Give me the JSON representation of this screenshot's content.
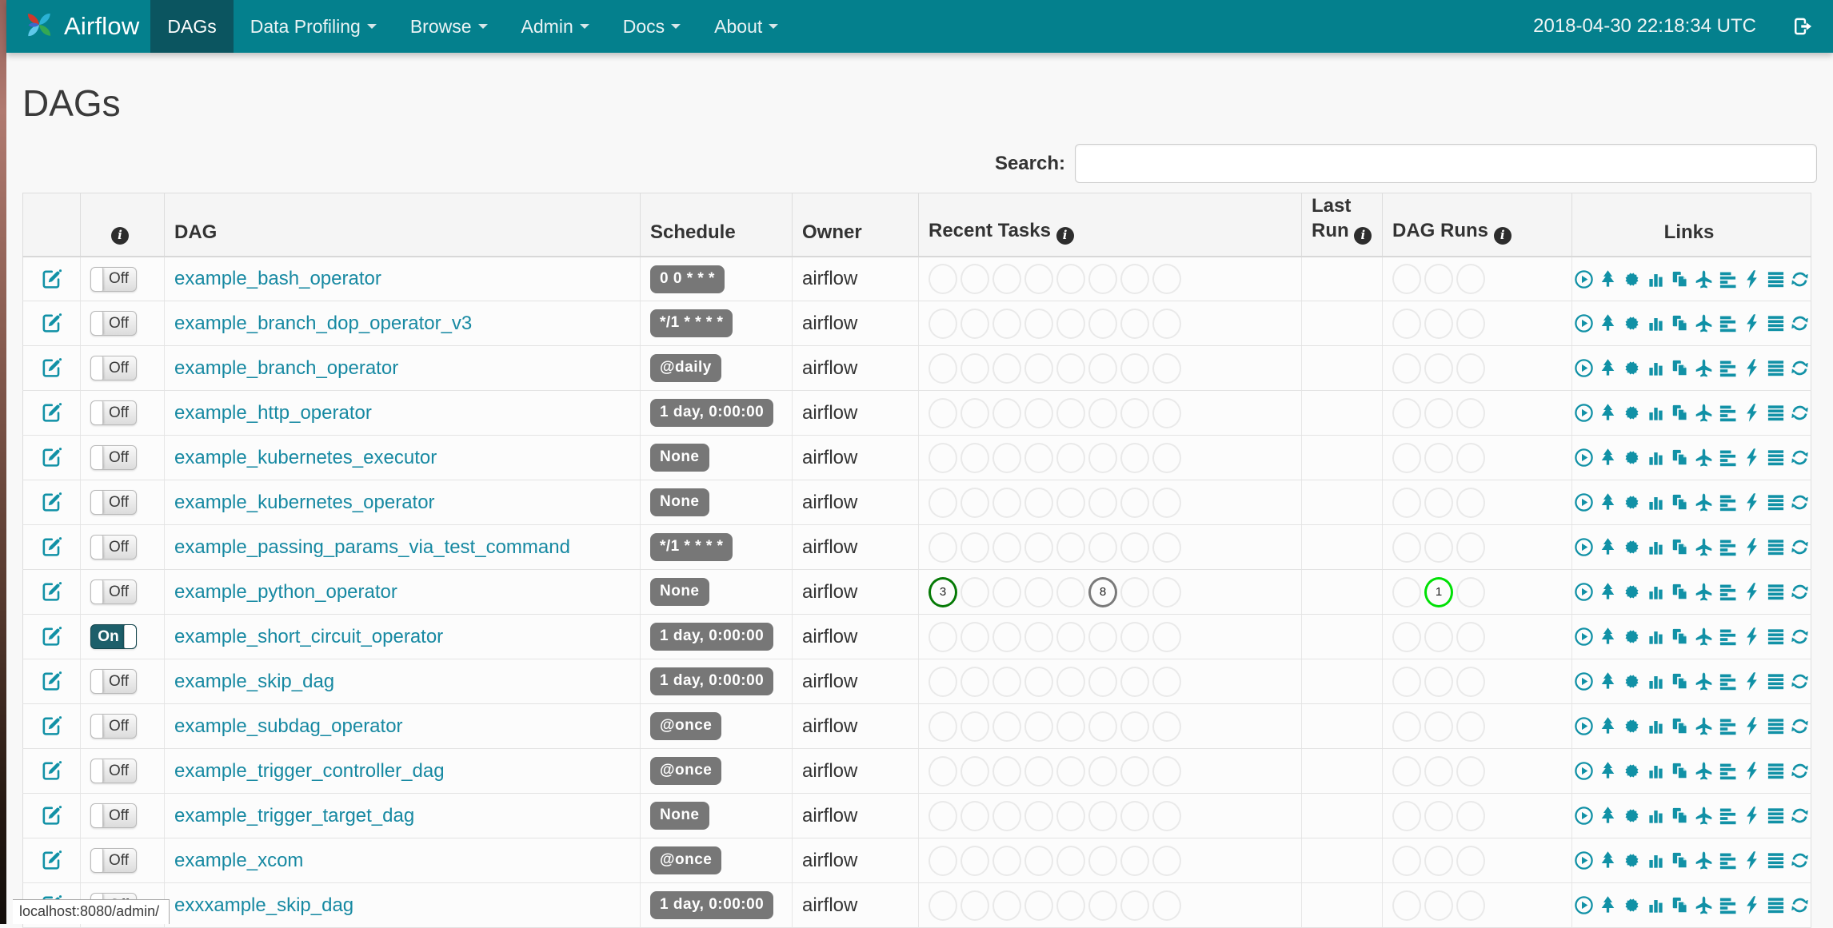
{
  "navbar": {
    "brand": "Airflow",
    "items": [
      {
        "label": "DAGs",
        "active": true,
        "caret": false
      },
      {
        "label": "Data Profiling",
        "active": false,
        "caret": true
      },
      {
        "label": "Browse",
        "active": false,
        "caret": true
      },
      {
        "label": "Admin",
        "active": false,
        "caret": true
      },
      {
        "label": "Docs",
        "active": false,
        "caret": true
      },
      {
        "label": "About",
        "active": false,
        "caret": true
      }
    ],
    "clock": "2018-04-30 22:18:34 UTC"
  },
  "page": {
    "title": "DAGs"
  },
  "search": {
    "label": "Search:",
    "value": "",
    "placeholder": ""
  },
  "table": {
    "headers": {
      "edit": "",
      "dag": "DAG",
      "schedule": "Schedule",
      "owner": "Owner",
      "recent_tasks": "Recent Tasks",
      "last_run": "Last Run",
      "dag_runs": "DAG Runs",
      "links": "Links"
    },
    "recent_task_slots": 8,
    "dag_run_slots": 3,
    "links": [
      "trigger-dag",
      "tree-view",
      "graph-view",
      "task-duration",
      "task-tries",
      "landing-times",
      "gantt-view",
      "code-view",
      "log-view",
      "refresh"
    ],
    "rows": [
      {
        "toggle": "Off",
        "dag": "example_bash_operator",
        "schedule": "0 0 * * *",
        "owner": "airflow",
        "last_run": "",
        "recent_tasks": [],
        "dag_runs": []
      },
      {
        "toggle": "Off",
        "dag": "example_branch_dop_operator_v3",
        "schedule": "*/1 * * * *",
        "owner": "airflow",
        "last_run": "",
        "recent_tasks": [],
        "dag_runs": []
      },
      {
        "toggle": "Off",
        "dag": "example_branch_operator",
        "schedule": "@daily",
        "owner": "airflow",
        "last_run": "",
        "recent_tasks": [],
        "dag_runs": []
      },
      {
        "toggle": "Off",
        "dag": "example_http_operator",
        "schedule": "1 day, 0:00:00",
        "owner": "airflow",
        "last_run": "",
        "recent_tasks": [],
        "dag_runs": []
      },
      {
        "toggle": "Off",
        "dag": "example_kubernetes_executor",
        "schedule": "None",
        "owner": "airflow",
        "last_run": "",
        "recent_tasks": [],
        "dag_runs": []
      },
      {
        "toggle": "Off",
        "dag": "example_kubernetes_operator",
        "schedule": "None",
        "owner": "airflow",
        "last_run": "",
        "recent_tasks": [],
        "dag_runs": []
      },
      {
        "toggle": "Off",
        "dag": "example_passing_params_via_test_command",
        "schedule": "*/1 * * * *",
        "owner": "airflow",
        "last_run": "",
        "recent_tasks": [],
        "dag_runs": []
      },
      {
        "toggle": "Off",
        "dag": "example_python_operator",
        "schedule": "None",
        "owner": "airflow",
        "last_run": "",
        "recent_tasks": [
          {
            "slot": 1,
            "count": "3",
            "state": "success"
          },
          {
            "slot": 6,
            "count": "8",
            "state": "queued"
          }
        ],
        "dag_runs": [
          {
            "slot": 2,
            "count": "1",
            "state": "running"
          }
        ]
      },
      {
        "toggle": "On",
        "dag": "example_short_circuit_operator",
        "schedule": "1 day, 0:00:00",
        "owner": "airflow",
        "last_run": "",
        "recent_tasks": [],
        "dag_runs": []
      },
      {
        "toggle": "Off",
        "dag": "example_skip_dag",
        "schedule": "1 day, 0:00:00",
        "owner": "airflow",
        "last_run": "",
        "recent_tasks": [],
        "dag_runs": []
      },
      {
        "toggle": "Off",
        "dag": "example_subdag_operator",
        "schedule": "@once",
        "owner": "airflow",
        "last_run": "",
        "recent_tasks": [],
        "dag_runs": []
      },
      {
        "toggle": "Off",
        "dag": "example_trigger_controller_dag",
        "schedule": "@once",
        "owner": "airflow",
        "last_run": "",
        "recent_tasks": [],
        "dag_runs": []
      },
      {
        "toggle": "Off",
        "dag": "example_trigger_target_dag",
        "schedule": "None",
        "owner": "airflow",
        "last_run": "",
        "recent_tasks": [],
        "dag_runs": []
      },
      {
        "toggle": "Off",
        "dag": "example_xcom",
        "schedule": "@once",
        "owner": "airflow",
        "last_run": "",
        "recent_tasks": [],
        "dag_runs": []
      },
      {
        "toggle": "Off",
        "dag": "exxxample_skip_dag",
        "schedule": "1 day, 0:00:00",
        "owner": "airflow",
        "last_run": "",
        "recent_tasks": [],
        "dag_runs": []
      }
    ]
  },
  "statusbar": {
    "url": "localhost:8080/admin/"
  },
  "colors": {
    "navbar": "#04808D",
    "navbar_active": "#0B5560",
    "accent": "#1191A6",
    "link": "#1789A2",
    "badge": "#777777",
    "state_success": "#067A06",
    "state_running": "#00E005",
    "state_queued": "#7A7A7A"
  }
}
